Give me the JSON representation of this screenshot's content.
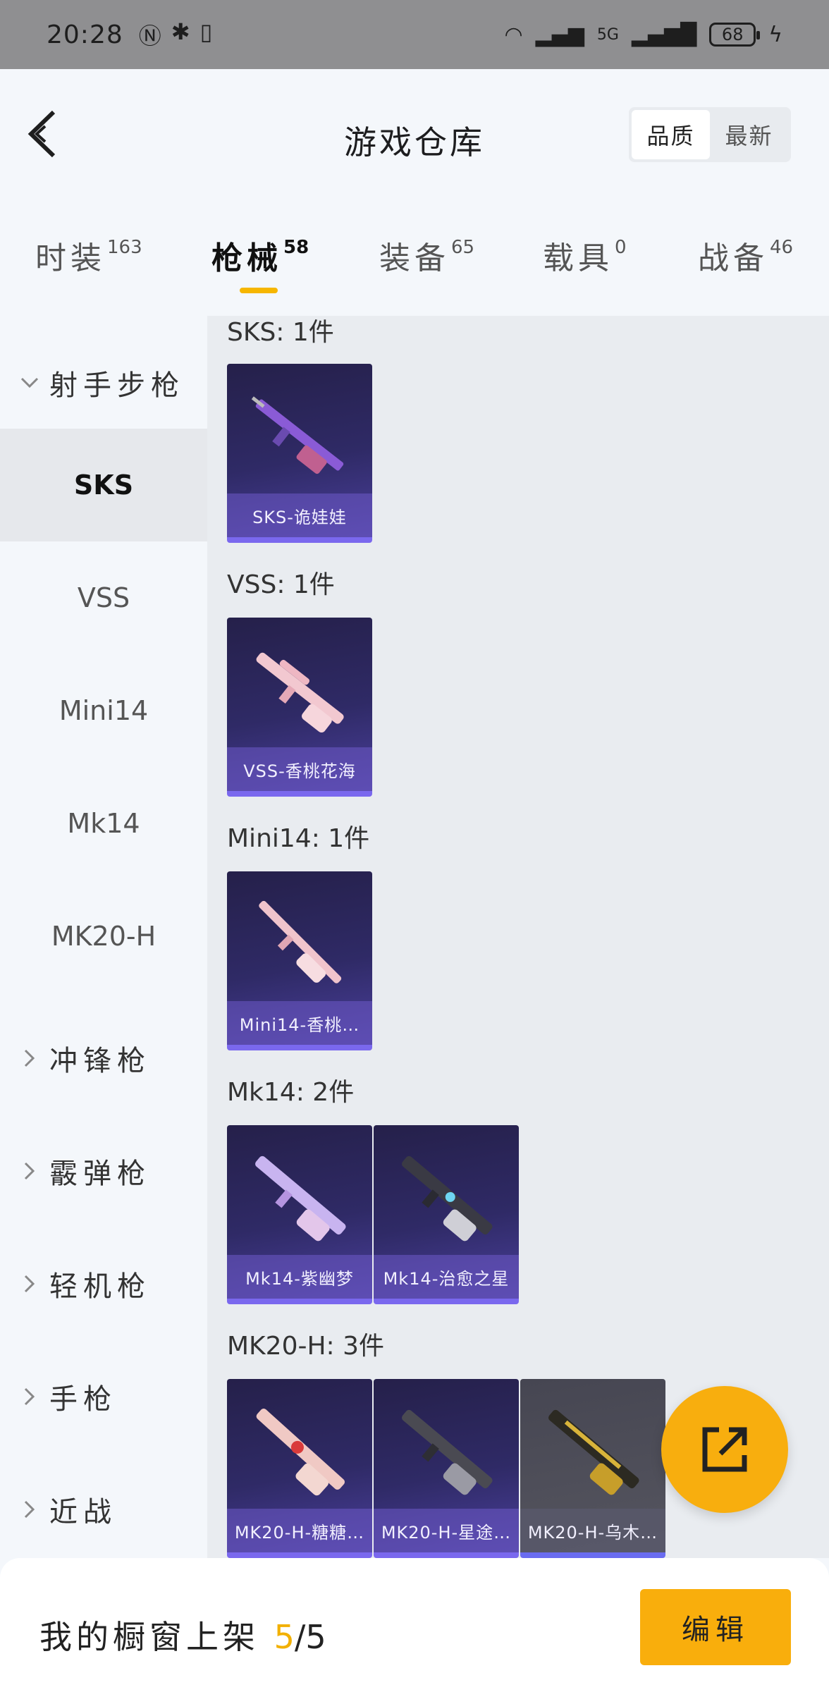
{
  "status": {
    "time": "20:28",
    "battery": "68",
    "network": "5G"
  },
  "header": {
    "title": "游戏仓库",
    "sort_options": [
      "品质",
      "最新"
    ],
    "active_sort": "品质"
  },
  "tabs": [
    {
      "label": "时装",
      "count": "163"
    },
    {
      "label": "枪械",
      "count": "58"
    },
    {
      "label": "装备",
      "count": "65"
    },
    {
      "label": "载具",
      "count": "0"
    },
    {
      "label": "战备",
      "count": "46"
    }
  ],
  "active_tab": "枪械",
  "sidebar": {
    "expanded_category": "射手步枪",
    "subitems": [
      "SKS",
      "VSS",
      "Mini14",
      "Mk14",
      "MK20-H"
    ],
    "active_subitem": "SKS",
    "categories": [
      "冲锋枪",
      "霰弹枪",
      "轻机枪",
      "手枪",
      "近战"
    ]
  },
  "groups": [
    {
      "label": "SKS: 1件",
      "items": [
        "SKS-诡娃娃"
      ]
    },
    {
      "label": "VSS: 1件",
      "items": [
        "VSS-香桃花海"
      ]
    },
    {
      "label": "Mini14: 1件",
      "items": [
        "Mini14-香桃…"
      ]
    },
    {
      "label": "Mk14: 2件",
      "items": [
        "Mk14-紫幽梦",
        "Mk14-治愈之星"
      ]
    },
    {
      "label": "MK20-H: 3件",
      "items": [
        "MK20-H-糖糖…",
        "MK20-H-星途…",
        "MK20-H-乌木…"
      ]
    }
  ],
  "bottom": {
    "showcase_label": "我的橱窗上架",
    "showcase_count": "5",
    "showcase_total": "/5",
    "edit_label": "编辑"
  },
  "colors": {
    "accent": "#f8ae0e",
    "card_bg": "#2f2a66",
    "card_border": "#7a68ee"
  }
}
